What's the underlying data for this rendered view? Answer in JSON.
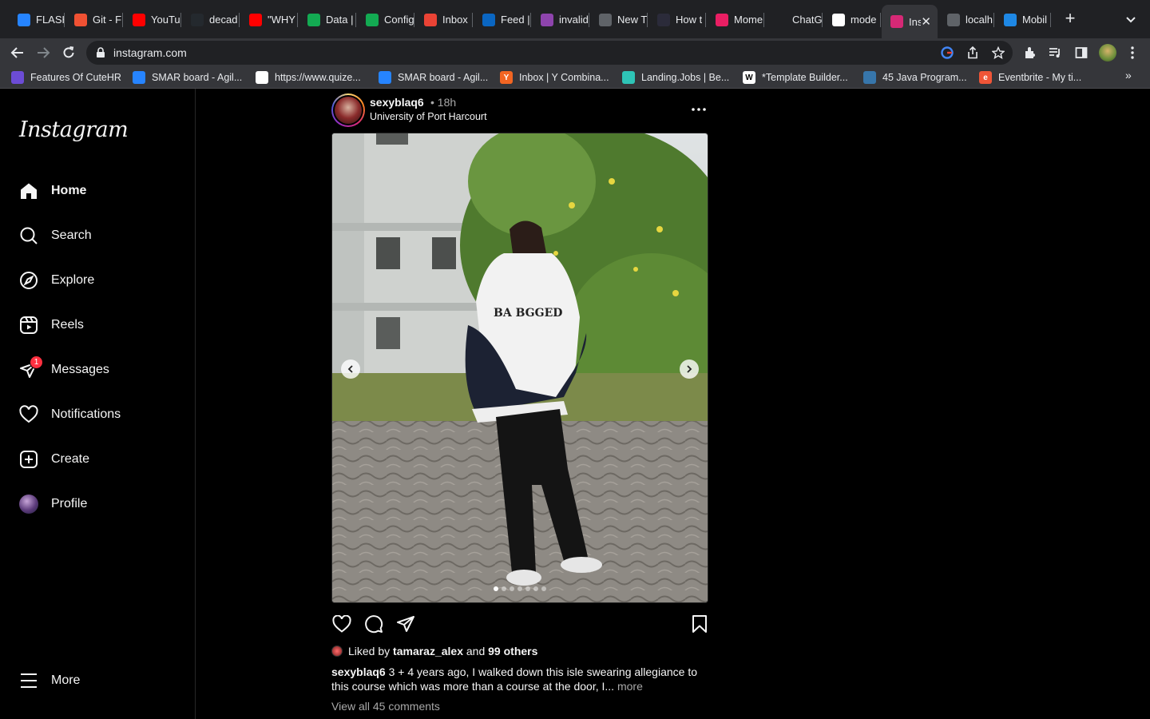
{
  "browser": {
    "tabs": [
      {
        "title": "FLASH",
        "icon": "jira-icon",
        "color": "#2684ff"
      },
      {
        "title": "Git - F",
        "icon": "git-icon",
        "color": "#f05133"
      },
      {
        "title": "YouTu",
        "icon": "youtube-icon",
        "color": "#ff0000"
      },
      {
        "title": "decad",
        "icon": "github-icon",
        "color": "#24292e"
      },
      {
        "title": "\"WHY",
        "icon": "youtube-icon",
        "color": "#ff0000"
      },
      {
        "title": "Data |",
        "icon": "mongodb-icon",
        "color": "#13aa52"
      },
      {
        "title": "Config",
        "icon": "mongodb-icon",
        "color": "#13aa52"
      },
      {
        "title": "Inbox",
        "icon": "gmail-icon",
        "color": "#ea4335"
      },
      {
        "title": "Feed |",
        "icon": "linkedin-icon",
        "color": "#0a66c2"
      },
      {
        "title": "invalid",
        "icon": "app-icon",
        "color": "#8e44ad"
      },
      {
        "title": "New T",
        "icon": "chrome-icon",
        "color": "#5f6368"
      },
      {
        "title": "How t",
        "icon": "astro-icon",
        "color": "#2b2b3a"
      },
      {
        "title": "Mome",
        "icon": "moment-icon",
        "color": "#e91e63"
      },
      {
        "title": "ChatG",
        "icon": "openai-icon",
        "color": "#202124"
      },
      {
        "title": "mode",
        "icon": "google-icon",
        "color": "#ffffff"
      },
      {
        "title": "Inst",
        "icon": "instagram-icon",
        "color": "#d62976"
      },
      {
        "title": "localh",
        "icon": "globe-icon",
        "color": "#5f6368"
      },
      {
        "title": "Mobil",
        "icon": "app-icon",
        "color": "#1e88e5"
      }
    ],
    "active_tab": 15,
    "url": "instagram.com",
    "bookmarks": [
      {
        "title": "Features Of CuteHR",
        "color": "#6c4cd6"
      },
      {
        "title": "SMAR board - Agil...",
        "color": "#2684ff"
      },
      {
        "title": "https://www.quize...",
        "color": "#ffffff"
      },
      {
        "title": "SMAR board - Agil...",
        "color": "#2684ff"
      },
      {
        "title": "Inbox | Y Combina...",
        "color": "#f26522",
        "letter": "Y"
      },
      {
        "title": "Landing.Jobs | Be...",
        "color": "#2ec4b6"
      },
      {
        "title": "*Template Builder...",
        "color": "#ffffff",
        "letter": "W"
      },
      {
        "title": "45 Java Program...",
        "color": "#3776ab"
      },
      {
        "title": "Eventbrite - My ti...",
        "color": "#f05537",
        "letter": "e"
      }
    ],
    "bookmarks_more": "»"
  },
  "sidebar": {
    "logo": "Instagram",
    "items": [
      {
        "label": "Home",
        "icon": "home-icon",
        "bold": true
      },
      {
        "label": "Search",
        "icon": "search-icon"
      },
      {
        "label": "Explore",
        "icon": "compass-icon"
      },
      {
        "label": "Reels",
        "icon": "reels-icon"
      },
      {
        "label": "Messages",
        "icon": "messenger-icon",
        "badge": "1"
      },
      {
        "label": "Notifications",
        "icon": "heart-icon"
      },
      {
        "label": "Create",
        "icon": "plus-square-icon"
      },
      {
        "label": "Profile",
        "icon": "avatar"
      }
    ],
    "more_label": "More"
  },
  "post": {
    "username": "sexyblaq6",
    "time": "• 18h",
    "location": "University of Port Harcourt",
    "slides_total": 7,
    "slide_active": 1,
    "likes_prefix": "Liked by",
    "liked_by_user": "tamaraz_alex",
    "likes_and": "and",
    "likes_others": "99 others",
    "caption_user": "sexyblaq6",
    "caption_text": "3 + 4 years ago, I walked down this isle swearing allegiance to this course which was more than a course at the door, I...",
    "caption_more": "more",
    "view_comments": "View all 45 comments",
    "jacket_text": "BA BGGED"
  },
  "colors": {
    "bg": "#000000",
    "text": "#f5f5f5",
    "muted": "#a8a8a8",
    "badge": "#ff3040",
    "chrome_dark": "#202124",
    "chrome_mid": "#35363a"
  }
}
